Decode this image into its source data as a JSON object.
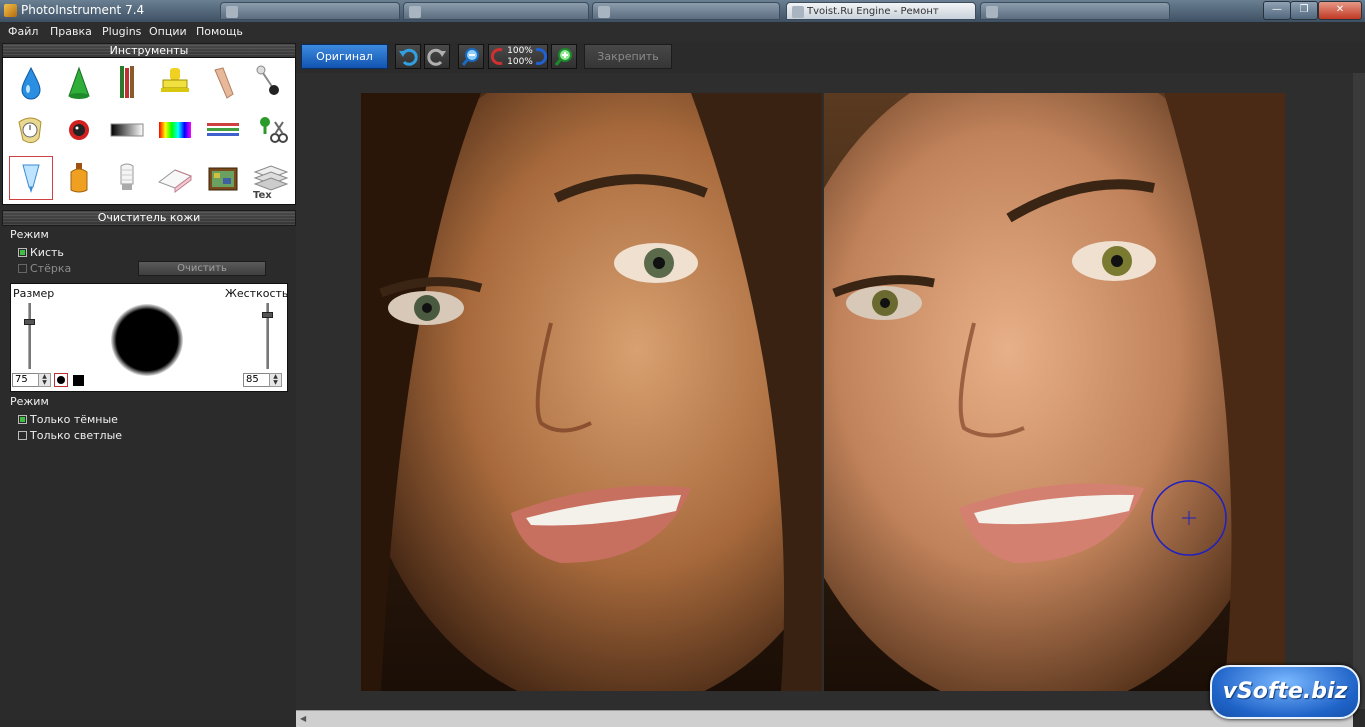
{
  "window": {
    "title": "PhotoInstrument 7.4",
    "taskbar_tabs": [
      {
        "label": ""
      },
      {
        "label": ""
      },
      {
        "label": ""
      },
      {
        "label": ""
      },
      {
        "label": "Tvoist.Ru Engine - Ремонт"
      },
      {
        "label": ""
      }
    ],
    "controls": {
      "minimize": "—",
      "restore": "❐",
      "close": "✕"
    }
  },
  "menu": {
    "items": [
      "Файл",
      "Правка",
      "Plugins",
      "Опции",
      "Помощь"
    ]
  },
  "tools_panel": {
    "header": "Инструменты",
    "tools": [
      {
        "icon": "water-drop-icon"
      },
      {
        "icon": "green-cone-icon"
      },
      {
        "icon": "pencils-icon"
      },
      {
        "icon": "stamp-icon"
      },
      {
        "icon": "concealer-tube-icon"
      },
      {
        "icon": "pin-icon"
      },
      {
        "icon": "melting-clock-icon"
      },
      {
        "icon": "red-eye-icon"
      },
      {
        "icon": "gray-gradient-icon"
      },
      {
        "icon": "rainbow-gradient-icon"
      },
      {
        "icon": "color-lines-icon"
      },
      {
        "icon": "scissors-pin-icon"
      },
      {
        "icon": "skin-cleaner-cone-icon"
      },
      {
        "icon": "perfume-bottle-icon"
      },
      {
        "icon": "light-bulb-icon"
      },
      {
        "icon": "eraser-icon"
      },
      {
        "icon": "tv-texture-icon"
      },
      {
        "icon": "text-stack-icon"
      }
    ],
    "selected_index": 12
  },
  "skin_cleaner_panel": {
    "header": "Очиститель кожи",
    "mode_label": "Режим",
    "brush_option": "Кисть",
    "eraser_option": "Стёрка",
    "brush_checked": true,
    "clear_button": "Очистить",
    "size_label": "Размер",
    "hardness_label": "Жесткость",
    "size_value": "75",
    "hardness_value": "85",
    "size_level": 0.75,
    "hardness_level": 0.85,
    "mode2_label": "Режим",
    "only_dark": "Только тёмные",
    "only_dark_checked": true,
    "only_light": "Только светлые",
    "only_light_checked": false
  },
  "toolbar": {
    "original_button": "Оригинал",
    "undo_icon": "undo-icon",
    "redo_icon": "redo-icon",
    "zoom_out_icon": "zoom-out-icon",
    "zoom_100_top": "100%",
    "zoom_100_bottom": "100%",
    "zoom_in_icon": "zoom-in-icon",
    "pin_button": "Закрепить"
  },
  "watermark": "vSofte.biz",
  "colors": {
    "accent_blue": "#1f63c8",
    "panel_bg": "#2b2b2b",
    "checkbox_green": "#3fbf3f"
  }
}
